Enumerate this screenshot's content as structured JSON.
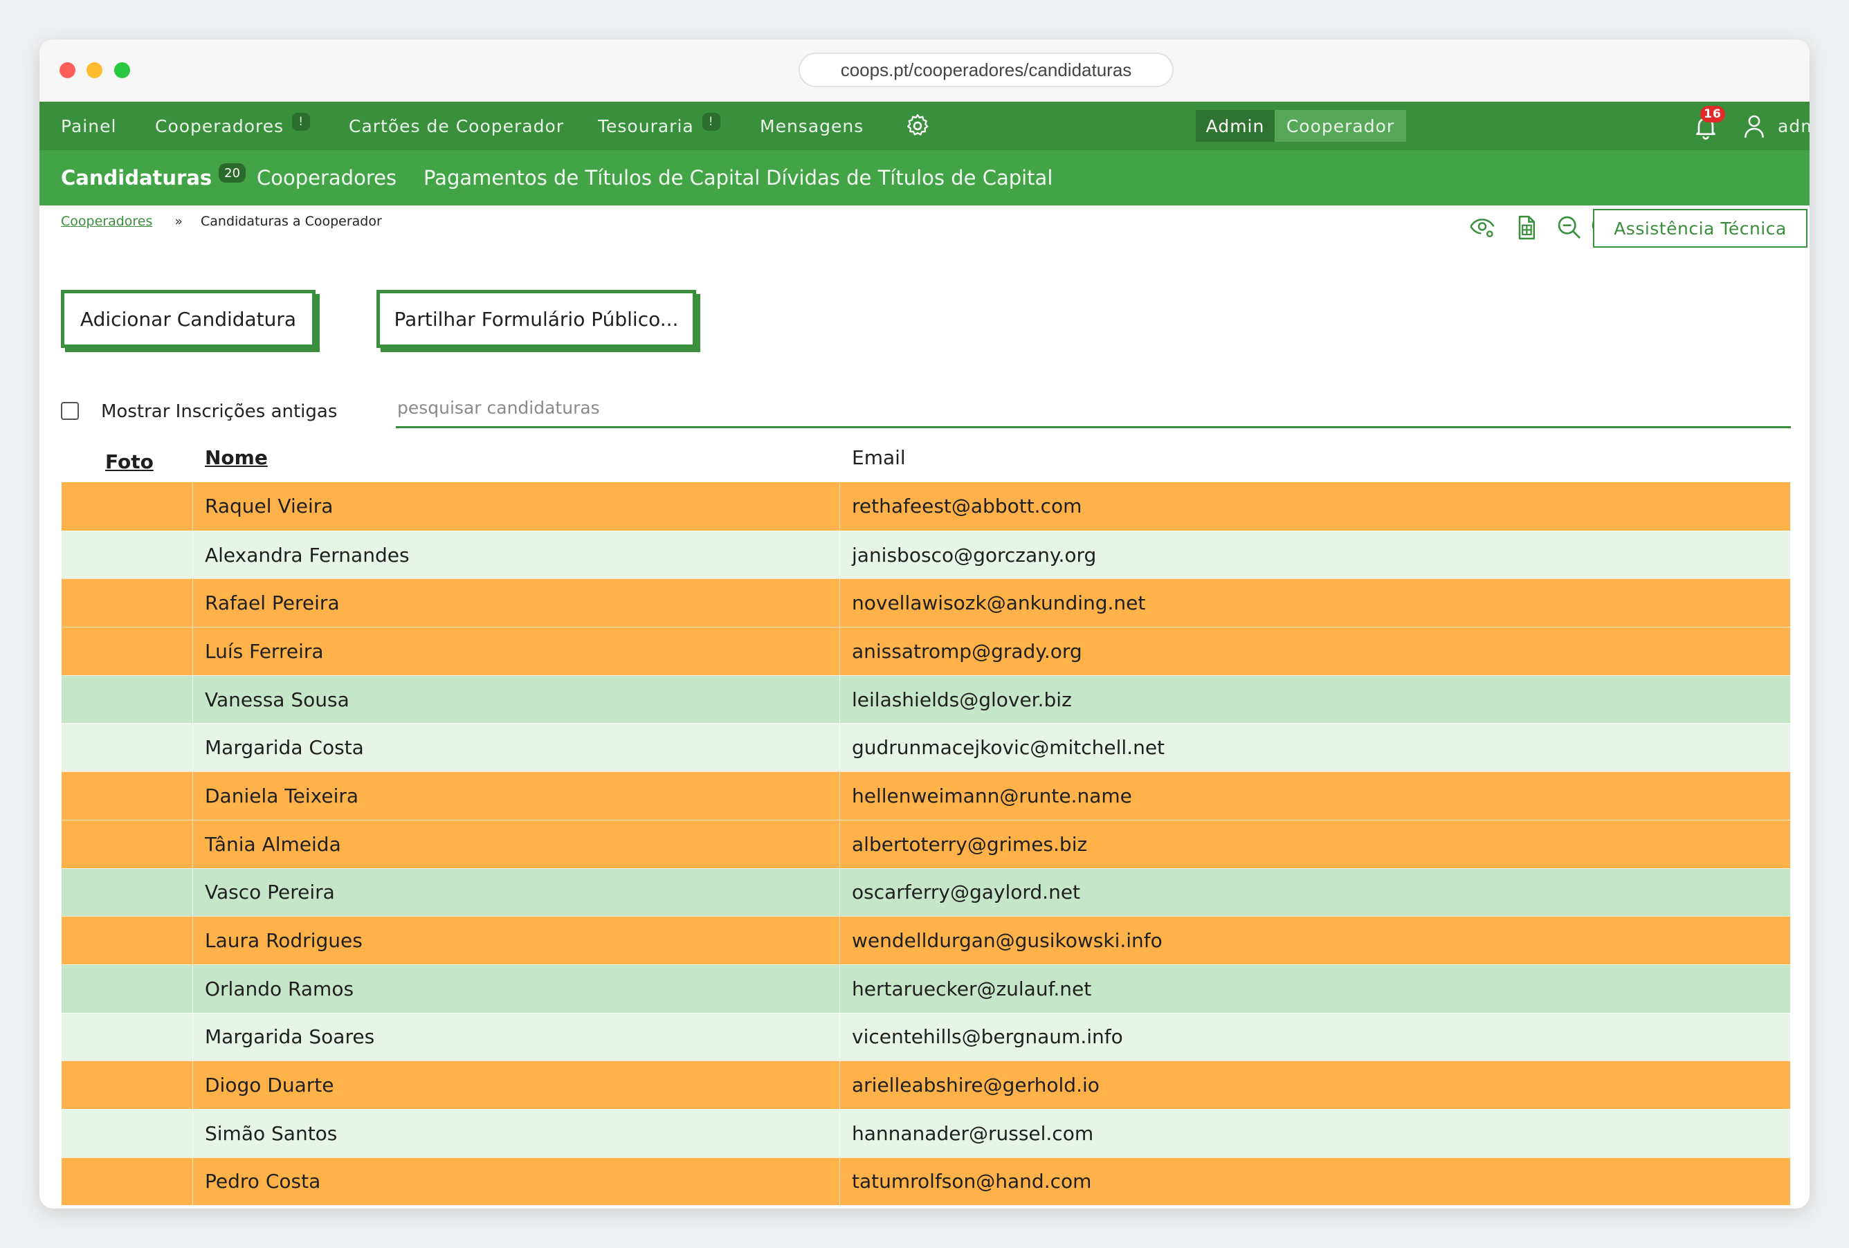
{
  "browser": {
    "url": "coops.pt/cooperadores/candidaturas"
  },
  "topnav": {
    "items": [
      {
        "label": "Painel"
      },
      {
        "label": "Cooperadores",
        "alert": "!"
      },
      {
        "label": "Cartões de Cooperador"
      },
      {
        "label": "Tesouraria",
        "alert": "!"
      },
      {
        "label": "Mensagens"
      }
    ],
    "settings_icon": "gear-icon",
    "roles": {
      "admin": "Admin",
      "cooperador": "Cooperador",
      "active": "Admin"
    },
    "notifications": {
      "icon": "bell-icon",
      "count": "16"
    },
    "user": {
      "icon": "user-icon",
      "name": "admin"
    }
  },
  "subnav": {
    "items": [
      {
        "label": "Candidaturas",
        "badge": "20",
        "active": true
      },
      {
        "label": "Cooperadores"
      },
      {
        "label": "Pagamentos de Títulos de Capital"
      },
      {
        "label": "Dívidas de Títulos de Capital"
      }
    ]
  },
  "breadcrumb": {
    "parent": "Cooperadores",
    "separator": "»",
    "current": "Candidaturas a Cooperador"
  },
  "tools": {
    "icons": [
      "eye-settings-icon",
      "spreadsheet-icon",
      "zoom-out-icon",
      "zoom-in-icon"
    ],
    "support_label": "Assistência Técnica"
  },
  "actions": {
    "add_label": "Adicionar Candidatura",
    "share_label": "Partilhar Formulário Público..."
  },
  "filters": {
    "show_old_label": "Mostrar Inscrições antigas",
    "show_old_checked": false,
    "search_placeholder": "pesquisar candidaturas",
    "search_value": ""
  },
  "table": {
    "columns": {
      "photo": "Foto",
      "name": "Nome",
      "email": "Email"
    },
    "rows": [
      {
        "name": "Raquel Vieira",
        "email": "rethafeest@abbott.com",
        "color": "orange"
      },
      {
        "name": "Alexandra Fernandes",
        "email": "janisbosco@gorczany.org",
        "color": "light"
      },
      {
        "name": "Rafael Pereira",
        "email": "novellawisozk@ankunding.net",
        "color": "orange"
      },
      {
        "name": "Luís Ferreira",
        "email": "anissatromp@grady.org",
        "color": "orange"
      },
      {
        "name": "Vanessa Sousa",
        "email": "leilashields@glover.biz",
        "color": "green"
      },
      {
        "name": "Margarida Costa",
        "email": "gudrunmacejkovic@mitchell.net",
        "color": "light"
      },
      {
        "name": "Daniela Teixeira",
        "email": "hellenweimann@runte.name",
        "color": "orange"
      },
      {
        "name": "Tânia Almeida",
        "email": "albertoterry@grimes.biz",
        "color": "orange"
      },
      {
        "name": "Vasco Pereira",
        "email": "oscarferry@gaylord.net",
        "color": "green"
      },
      {
        "name": "Laura Rodrigues",
        "email": "wendelldurgan@gusikowski.info",
        "color": "orange"
      },
      {
        "name": "Orlando Ramos",
        "email": "hertaruecker@zulauf.net",
        "color": "green"
      },
      {
        "name": "Margarida Soares",
        "email": "vicentehills@bergnaum.info",
        "color": "light"
      },
      {
        "name": "Diogo Duarte",
        "email": "arielleabshire@gerhold.io",
        "color": "orange"
      },
      {
        "name": "Simão Santos",
        "email": "hannanader@russel.com",
        "color": "light"
      },
      {
        "name": "Pedro Costa",
        "email": "tatumrolfson@hand.com",
        "color": "orange"
      }
    ]
  },
  "colors": {
    "nav_dark": "#3a8f3c",
    "nav_light": "#43a447",
    "row_orange": "#ffb14a",
    "row_green": "#c6e6c8",
    "row_light": "#e7f5e8",
    "badge_red": "#e02b2b"
  }
}
